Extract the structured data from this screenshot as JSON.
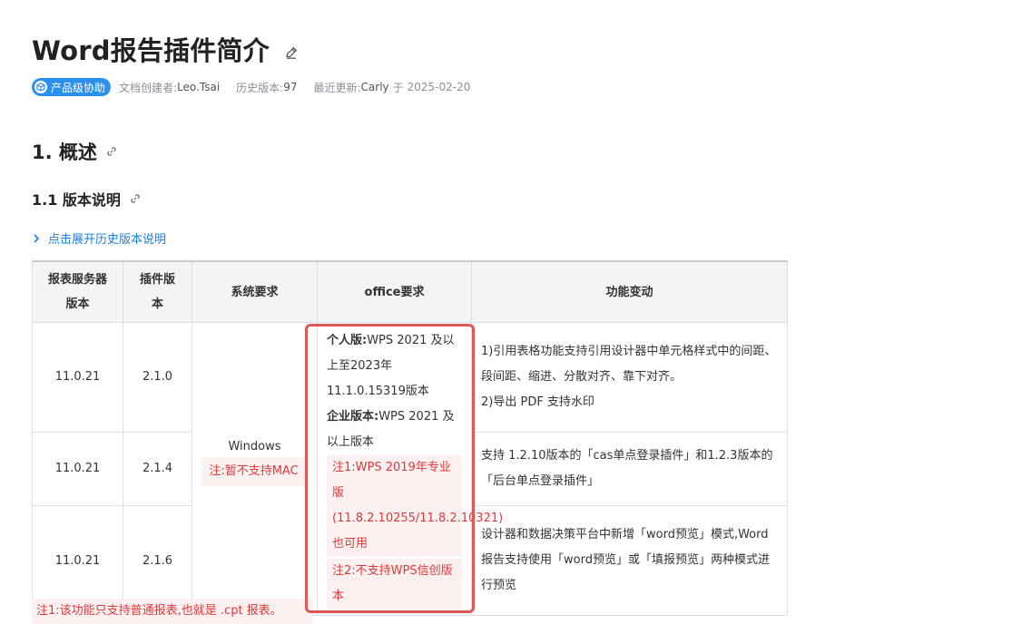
{
  "header": {
    "title": "Word报告插件简介",
    "badge": "产品级协助",
    "creator_key": "文档创建者:",
    "creator": "Leo.Tsai",
    "history_key": "历史版本:",
    "history": "97",
    "updated_key": "最近更新:",
    "updated_by": "Carly",
    "updated_mid": "于",
    "updated_date": "2025-02-20"
  },
  "sections": {
    "h1": "1. 概述",
    "h2": "1.1 版本说明",
    "expand": "点击展开历史版本说明"
  },
  "table": {
    "headers": [
      "报表服务器版本",
      "插件版本",
      "系统要求",
      "office要求",
      "功能变动"
    ],
    "rows": [
      {
        "server": "11.0.21",
        "plugin": "2.1.0",
        "func": "1)引用表格功能支持引用设计器中单元格样式中的间距、段间距、缩进、分散对齐、靠下对齐。\n2)导出 PDF 支持水印"
      },
      {
        "server": "11.0.21",
        "plugin": "2.1.4",
        "func": "支持 1.2.10版本的「cas单点登录插件」和1.2.3版本的「后台单点登录插件」"
      },
      {
        "server": "11.0.21",
        "plugin": "2.1.6",
        "func": "设计器和数据决策平台中新增「word预览」模式,Word报告支持使用「word预览」或「填报预览」两种模式进行预览"
      }
    ],
    "system": {
      "os": "Windows",
      "note": "注:暂不支持MAC"
    },
    "office": {
      "personal_label": "个人版:",
      "personal_text": "WPS 2021 及以上至2023年11.1.0.15319版本",
      "enterprise_label": "企业版本:",
      "enterprise_text": "WPS 2021 及以上版本",
      "note1": "注1:WPS 2019年专业版(11.8.2.10255/11.8.2.10321)也可用",
      "note2": "注2:不支持WPS信创版本"
    }
  },
  "footnote": "注1:该功能只支持普通报表,也就是 .cpt 报表。",
  "colors": {
    "accent": "#2b8ff0",
    "link": "#1b7fe0",
    "warning": "#e03a3a",
    "highlight": "#e05555"
  }
}
